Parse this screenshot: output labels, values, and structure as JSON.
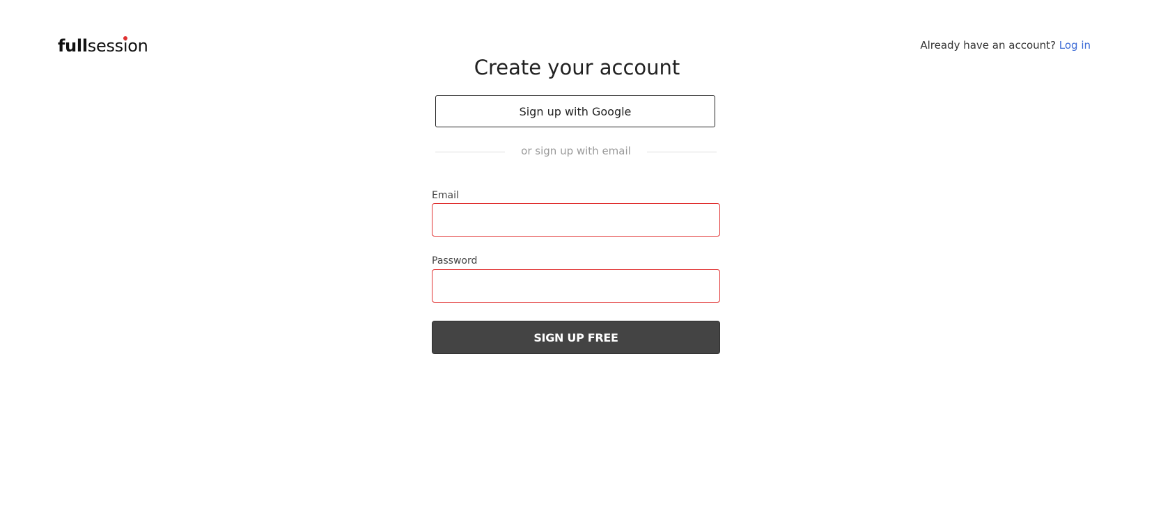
{
  "header": {
    "logo": {
      "bold": "full",
      "light_pre": "sess",
      "light_i": "i",
      "light_post": "on",
      "dot_color": "#e03131"
    },
    "login_prompt": "Already have an account?",
    "login_link": "Log in"
  },
  "form": {
    "title": "Create your account",
    "google_button": "Sign up with Google",
    "divider_text": "or sign up with email",
    "email_label": "Email",
    "email_value": "",
    "password_label": "Password",
    "password_value": "",
    "submit_button": "SIGN UP FREE"
  },
  "colors": {
    "accent_link": "#3b6ad6",
    "error_border": "#e03131",
    "submit_bg": "#444444"
  }
}
